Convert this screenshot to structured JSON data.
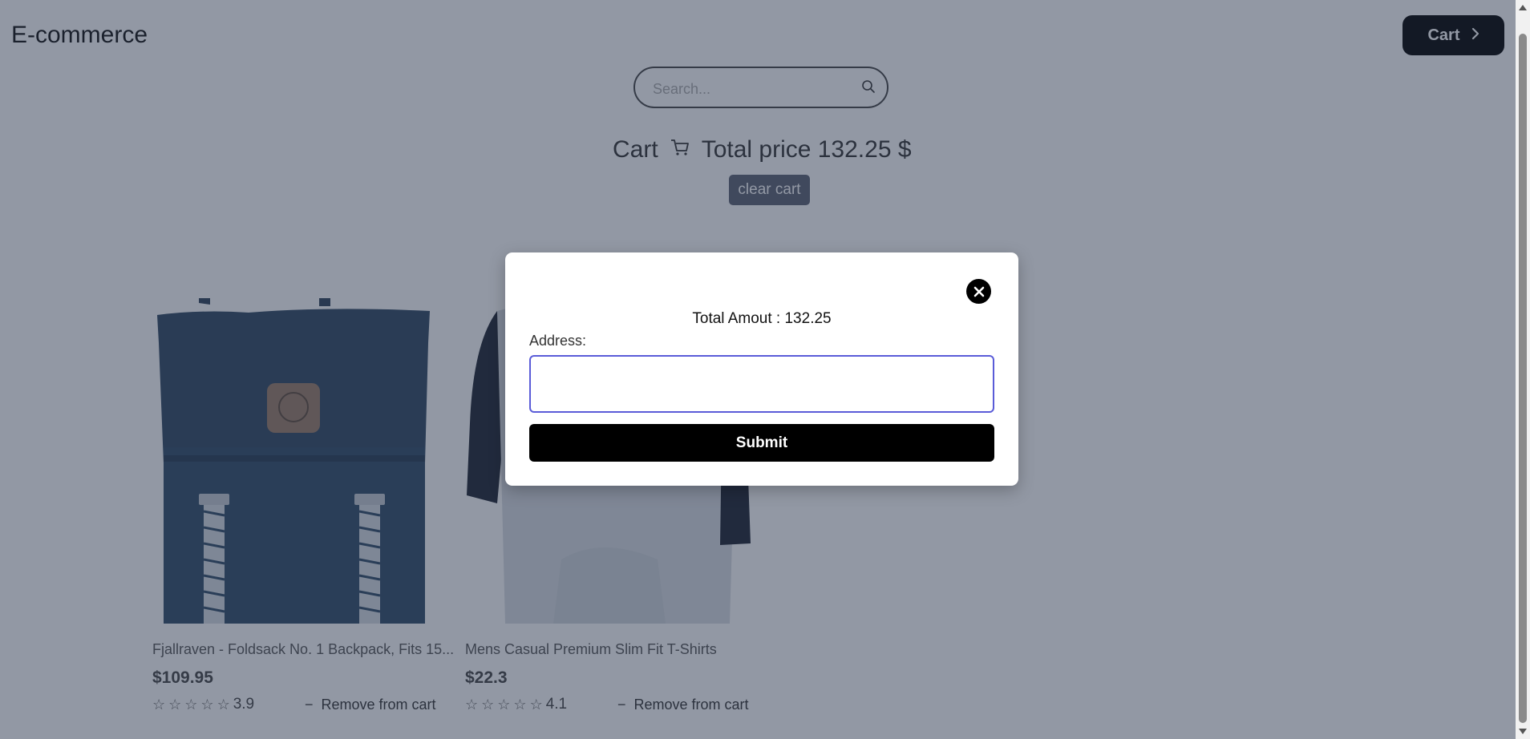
{
  "header": {
    "brand": "E-commerce",
    "cart_button_label": "Cart"
  },
  "search": {
    "placeholder": "Search..."
  },
  "cart_summary": {
    "title": "Cart",
    "total_text": "Total price 132.25 $",
    "clear_label": "clear cart"
  },
  "products": [
    {
      "title": "Fjallraven - Foldsack No. 1 Backpack, Fits 15...",
      "price": "$109.95",
      "rating": "3.9",
      "remove_label": "Remove from cart"
    },
    {
      "title": "Mens Casual Premium Slim Fit T-Shirts",
      "price": "$22.3",
      "rating": "4.1",
      "remove_label": "Remove from cart"
    }
  ],
  "modal": {
    "total_text": "Total Amout : 132.25",
    "address_label": "Address:",
    "address_value": "",
    "submit_label": "Submit"
  },
  "colors": {
    "overlay": "#253249",
    "primary": "#000000",
    "focus_border": "#5a5cd8"
  },
  "icons": [
    "chevron-right-icon",
    "search-icon",
    "cart-icon",
    "star-icon",
    "close-icon"
  ]
}
